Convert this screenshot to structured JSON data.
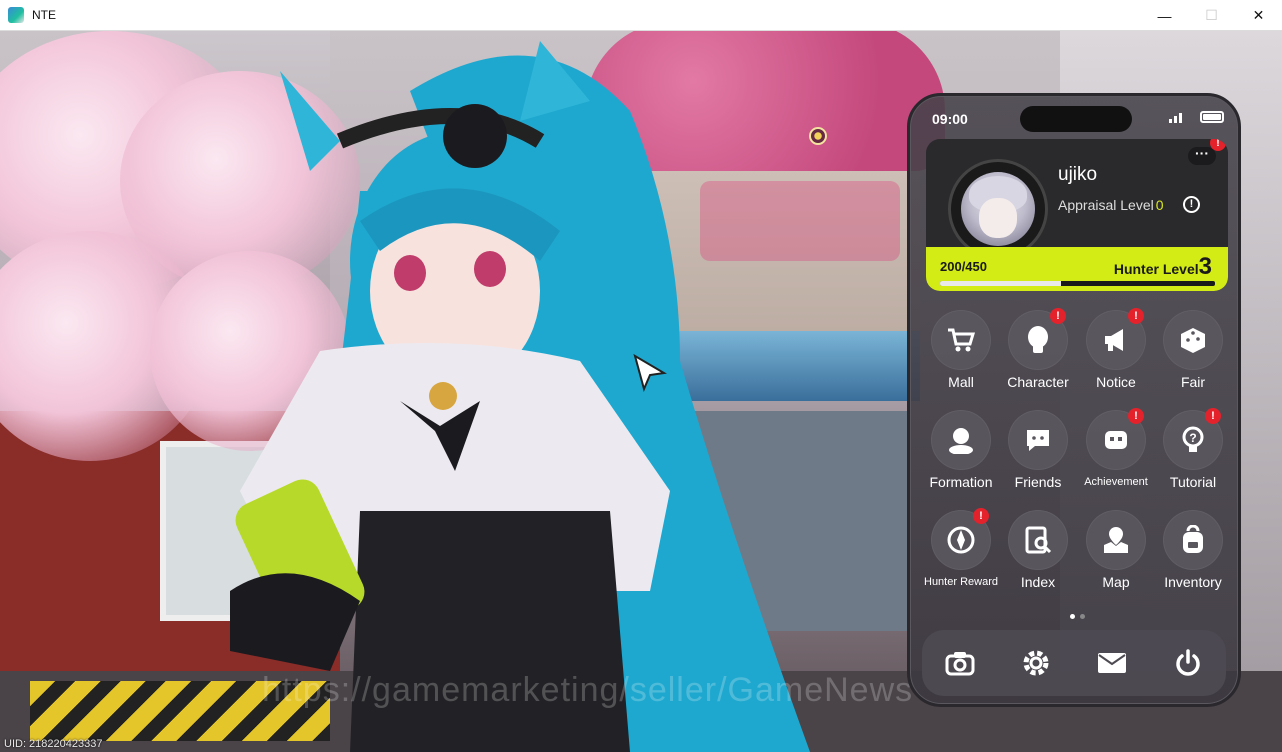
{
  "window": {
    "title": "NTE",
    "minimize": "—",
    "maximize": "☐",
    "close": "✕"
  },
  "scene": {
    "watermark": "https://gamemarketing/seller/GameNews",
    "uid": "UID: 218220423337"
  },
  "phone": {
    "time": "09:00",
    "profile": {
      "name": "ujiko",
      "appraisal_label": "Appraisal Level",
      "appraisal_level": "0",
      "exp": "200/450",
      "exp_fraction": 0.44,
      "hunter_label": "Hunter Level",
      "hunter_level": "3",
      "more_badge": "!"
    },
    "apps": [
      {
        "label": "Mall",
        "icon": "cart-icon",
        "badge": ""
      },
      {
        "label": "Character",
        "icon": "character-icon",
        "badge": "!"
      },
      {
        "label": "Notice",
        "icon": "megaphone-icon",
        "badge": "!"
      },
      {
        "label": "Fair",
        "icon": "dice-icon",
        "badge": ""
      },
      {
        "label": "Formation",
        "icon": "formation-icon",
        "badge": ""
      },
      {
        "label": "Friends",
        "icon": "chat-icon",
        "badge": ""
      },
      {
        "label": "Achievement",
        "icon": "robot-icon",
        "badge": "!"
      },
      {
        "label": "Tutorial",
        "icon": "lightbulb-icon",
        "badge": "!"
      },
      {
        "label": "Hunter Reward",
        "icon": "compass-icon",
        "badge": "!"
      },
      {
        "label": "Index",
        "icon": "index-icon",
        "badge": ""
      },
      {
        "label": "Map",
        "icon": "map-icon",
        "badge": ""
      },
      {
        "label": "Inventory",
        "icon": "backpack-icon",
        "badge": ""
      }
    ],
    "page_dots": {
      "count": 2,
      "active": 0
    },
    "dock": [
      "camera-icon",
      "settings-icon",
      "mail-icon",
      "power-icon"
    ],
    "colors": {
      "accent": "#d4ec16",
      "badge": "#e4222c"
    }
  }
}
